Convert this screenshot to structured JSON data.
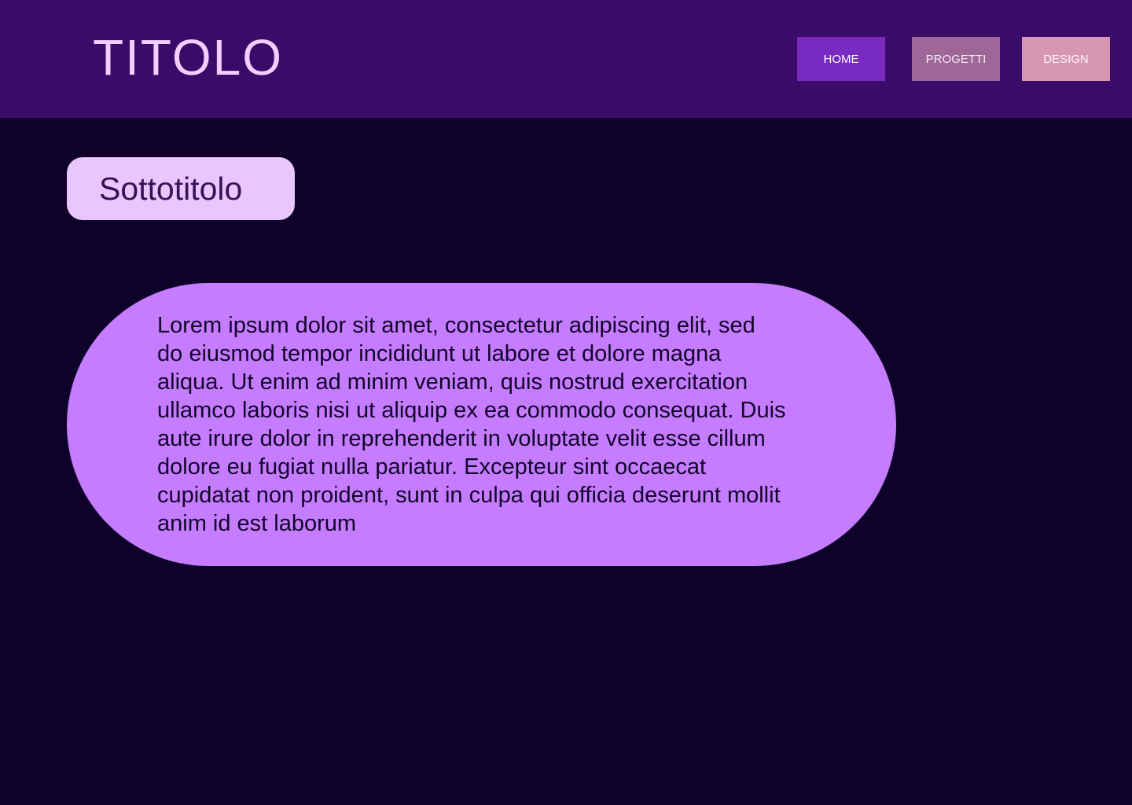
{
  "header": {
    "title": "TITOLO",
    "nav": [
      {
        "label": "HOME"
      },
      {
        "label": "PROGETTI"
      },
      {
        "label": "DESIGN"
      }
    ]
  },
  "main": {
    "subtitle": "Sottotitolo",
    "body_text": "Lorem ipsum dolor sit amet, consectetur adipiscing elit, sed do eiusmod tempor incididunt ut labore et dolore magna aliqua. Ut enim ad minim veniam, quis nostrud exercitation ullamco laboris nisi ut aliquip ex ea commodo consequat. Duis aute irure dolor in reprehenderit in voluptate velit esse cillum dolore eu fugiat nulla pariatur. Excepteur sint occaecat cupidatat non proident, sunt in culpa qui officia deserunt mollit anim id est laborum"
  },
  "colors": {
    "page_background": "#0E022A",
    "header_background": "#3B0B6A",
    "title_text": "#F2CFFF",
    "nav_home": "#782AC1",
    "nav_progetti": "#9F6698",
    "nav_design": "#D797B3",
    "subtitle_pill": "#EAC6FF",
    "content_blob": "#C57CFF"
  }
}
